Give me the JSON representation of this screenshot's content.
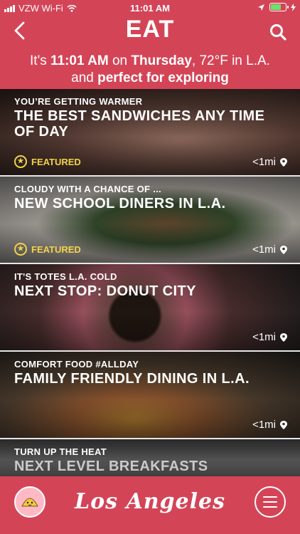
{
  "status": {
    "carrier": "VZW Wi-Fi",
    "time": "11:01 AM"
  },
  "header": {
    "title": "EAT",
    "sub_line1_prefix": "It's ",
    "sub_time": "11:01 AM",
    "sub_on": " on ",
    "sub_day": "Thursday",
    "sub_temp": ", 72°F in L.A.",
    "sub_line2_prefix": "and ",
    "sub_line2_bold": "perfect for exploring"
  },
  "cards": [
    {
      "eyebrow": "YOU’RE GETTING WARMER",
      "headline": "THE BEST SANDWICHES ANY TIME OF DAY",
      "badge": "FEATURED",
      "distance": "<1mi"
    },
    {
      "eyebrow": "CLOUDY WITH A CHANCE OF ...",
      "headline": "NEW SCHOOL DINERS IN L.A.",
      "badge": "FEATURED",
      "distance": "<1mi"
    },
    {
      "eyebrow": "IT'S TOTES L.A. COLD",
      "headline": "NEXT STOP: DONUT CITY",
      "badge": "",
      "distance": "<1mi"
    },
    {
      "eyebrow": "COMFORT FOOD #ALLDAY",
      "headline": "FAMILY FRIENDLY DINING IN L.A.",
      "badge": "",
      "distance": "<1mi"
    },
    {
      "eyebrow": "TURN UP THE HEAT",
      "headline": "NEXT LEVEL BREAKFASTS",
      "badge": "",
      "distance": ""
    }
  ],
  "footer": {
    "logo": "Los Angeles"
  },
  "colors": {
    "brand": "#d44457",
    "featured": "#f2d24a"
  }
}
